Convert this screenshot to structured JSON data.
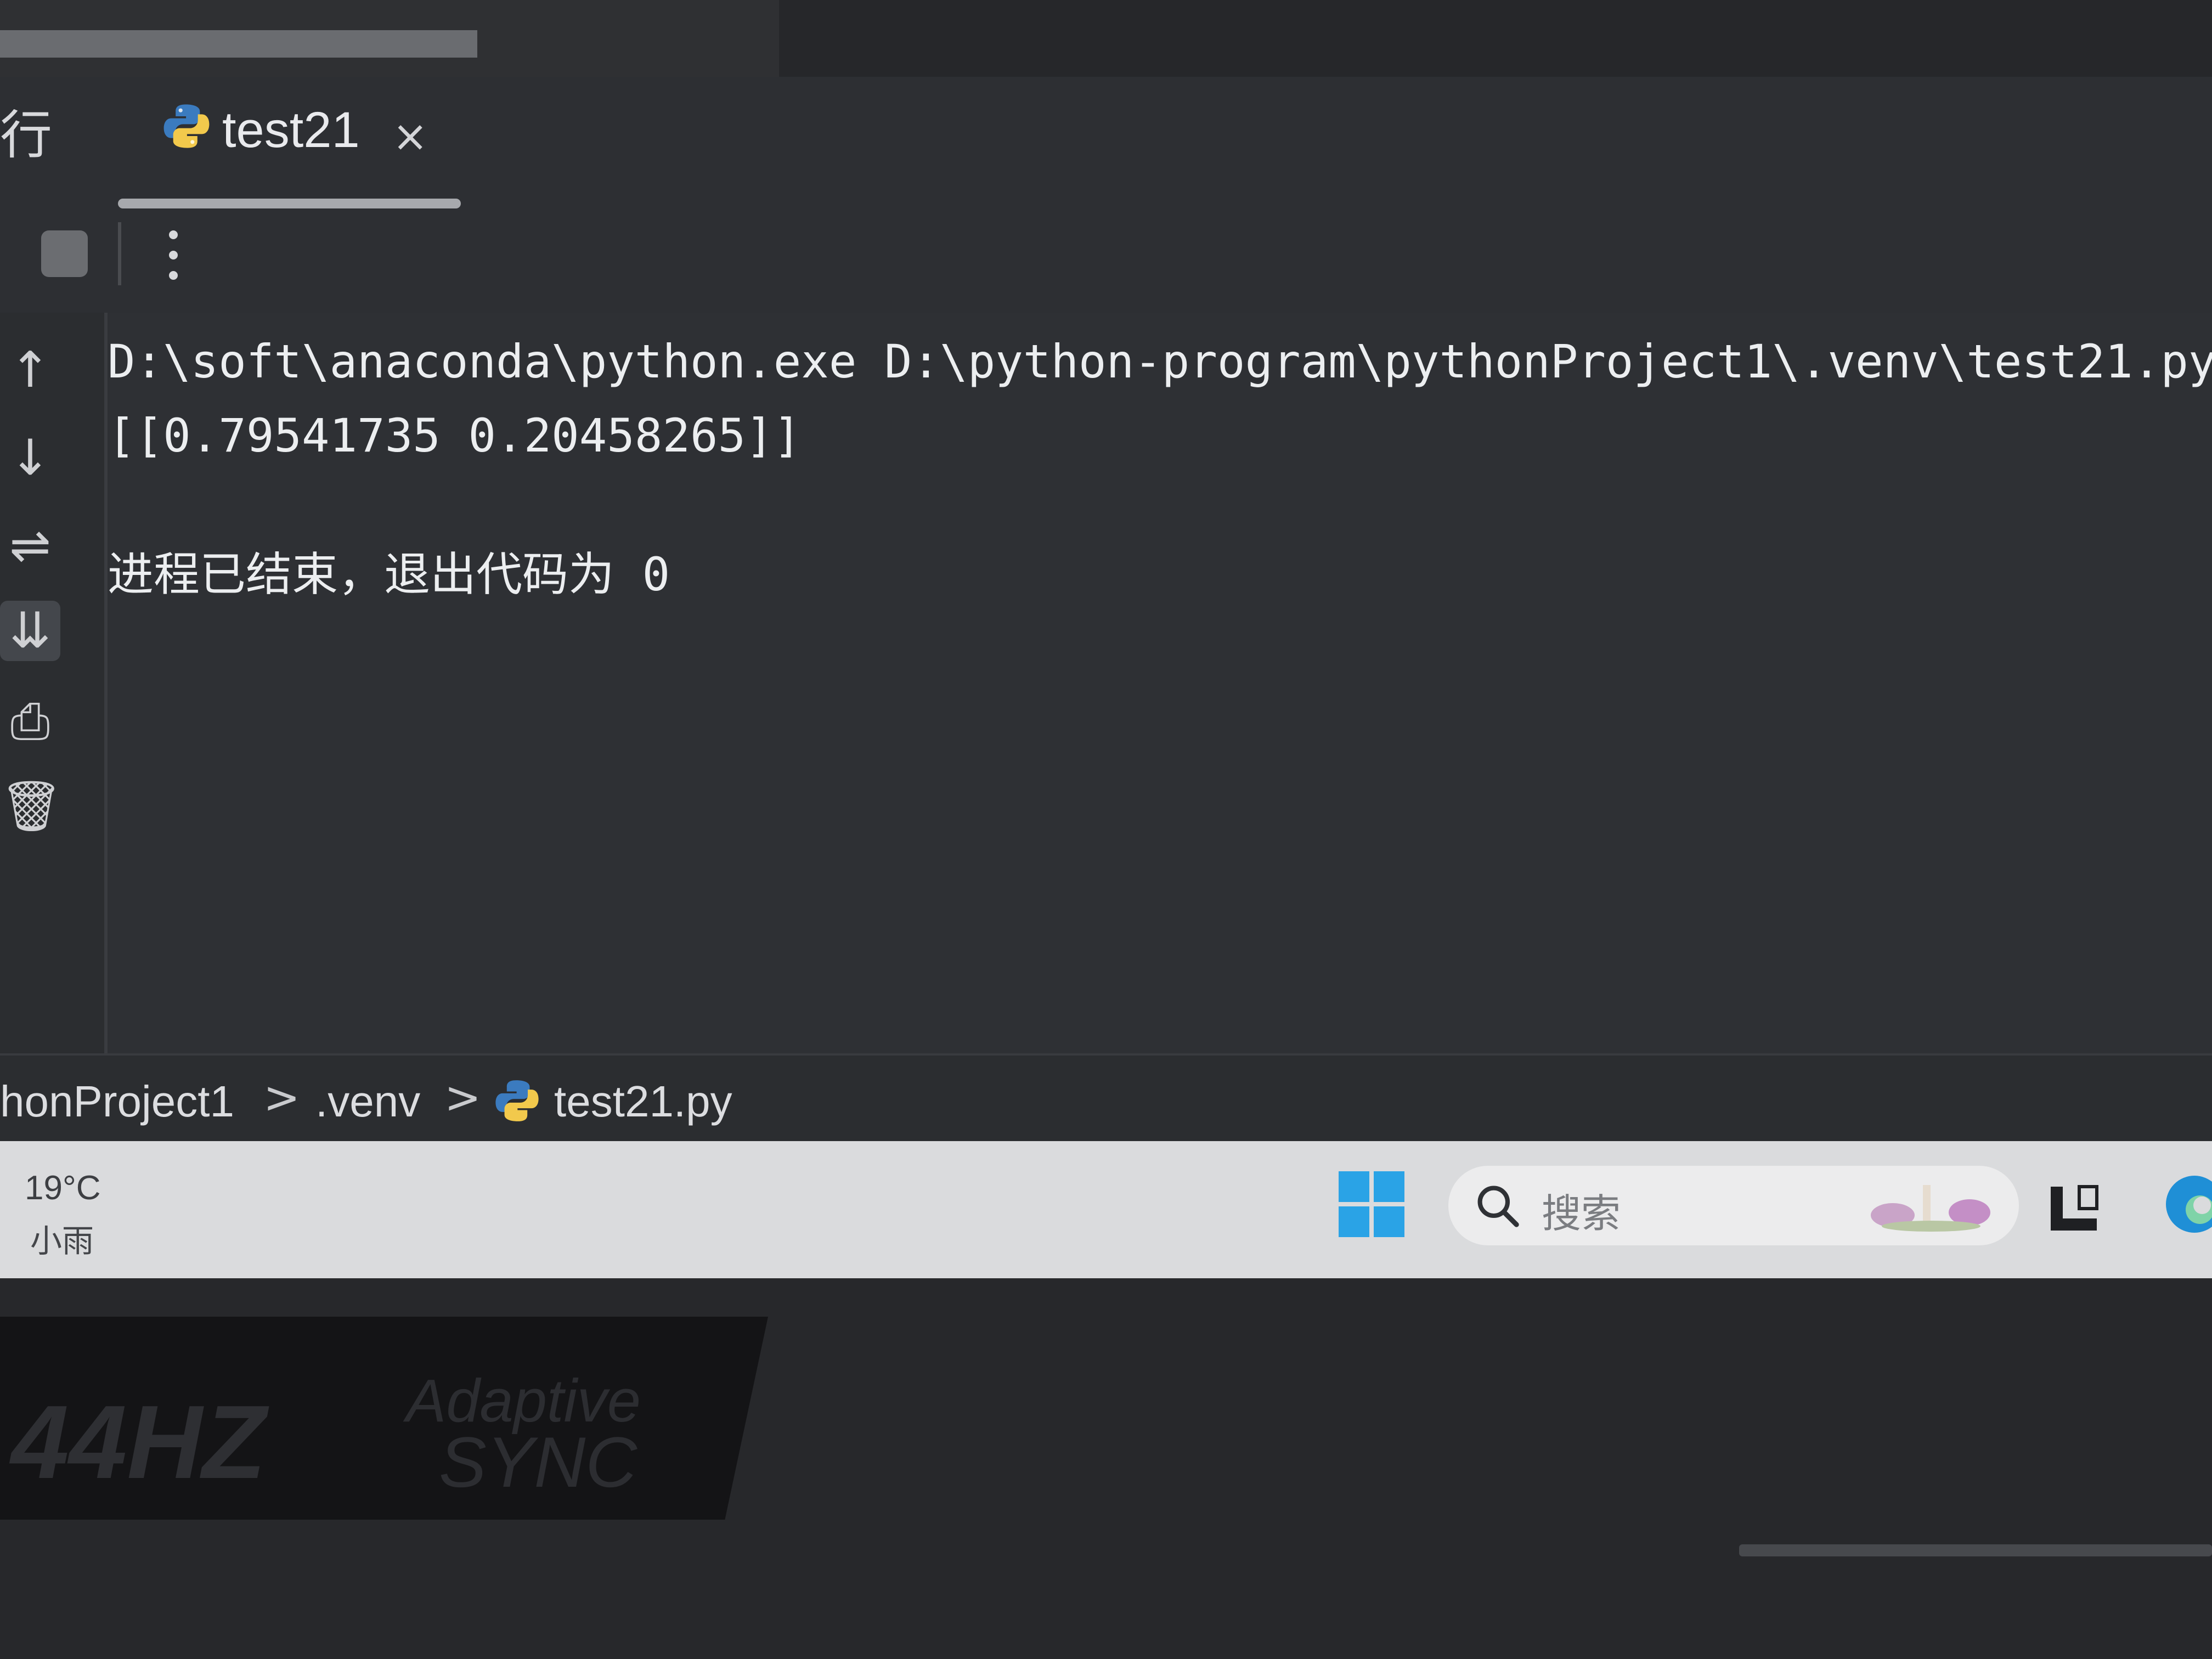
{
  "colors": {
    "ide_background": "#2b2d30",
    "console_text": "#eceef0",
    "taskbar": "#dadbdd",
    "windows_blue": "#2aa3e6",
    "python_blue": "#3b7bbf",
    "python_yellow": "#f2c94c"
  },
  "run_panel": {
    "label": "行",
    "tab": {
      "title": "test21",
      "icon": "python-icon",
      "close_glyph": "×"
    },
    "toolbar": {
      "stop_icon": "stop-icon",
      "more_icon": "more-vertical-icon"
    },
    "side_toolbar": [
      {
        "icon": "arrow-up-icon",
        "glyph": "↑"
      },
      {
        "icon": "arrow-down-icon",
        "glyph": "↓"
      },
      {
        "icon": "soft-wrap-icon",
        "glyph": "⇌"
      },
      {
        "icon": "scroll-to-end-icon",
        "glyph": "⇊",
        "active": true
      },
      {
        "icon": "print-icon",
        "glyph": "⎙"
      },
      {
        "icon": "trash-icon",
        "glyph": "🗑"
      }
    ]
  },
  "console": {
    "command": "D:\\soft\\anaconda\\python.exe D:\\python-program\\pythonProject1\\.venv\\test21.py",
    "output": "[[0.79541735 0.20458265]]",
    "exit_message": "进程已结束，退出代码为 0"
  },
  "breadcrumb": {
    "items": [
      "honProject1",
      ".venv",
      "test21.py"
    ],
    "separator": ">",
    "file_icon": "python-icon"
  },
  "taskbar": {
    "weather": {
      "temperature": "19°C",
      "condition": "小雨"
    },
    "start_icon": "windows-start-icon",
    "search": {
      "icon": "search-icon",
      "placeholder": "搜索"
    },
    "task_view_icon": "task-view-icon",
    "edge_icon": "edge-browser-icon"
  },
  "bezel": {
    "sticker_hz": "44HZ",
    "sticker_line1": "Adaptive",
    "sticker_line2": "SYNC"
  }
}
